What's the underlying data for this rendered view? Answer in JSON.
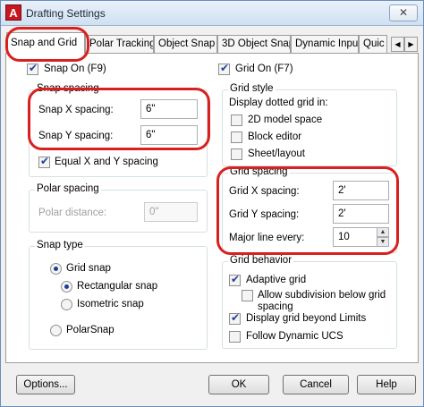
{
  "window": {
    "title": "Drafting Settings",
    "close_glyph": "✕",
    "app_icon_letter": "A"
  },
  "tabs": [
    "Snap and Grid",
    "Polar Tracking",
    "Object Snap",
    "3D Object Snap",
    "Dynamic Input",
    "Quic"
  ],
  "snap": {
    "snap_on_label": "Snap On (F9)",
    "snap_on_checked": true,
    "spacing_group": "Snap spacing",
    "x_label": "Snap X spacing:",
    "x_value": "6\"",
    "y_label": "Snap Y spacing:",
    "y_value": "6\"",
    "equal_label": "Equal X and Y spacing",
    "equal_checked": true
  },
  "polar": {
    "group": "Polar spacing",
    "distance_label": "Polar distance:",
    "distance_value": "0\""
  },
  "snap_type": {
    "group": "Snap type",
    "grid_snap": "Grid snap",
    "rectangular": "Rectangular snap",
    "isometric": "Isometric snap",
    "polarsnap": "PolarSnap"
  },
  "grid": {
    "grid_on_label": "Grid On (F7)",
    "grid_on_checked": true,
    "style_group": "Grid style",
    "style_desc": "Display dotted grid in:",
    "model_space": "2D model space",
    "block_editor": "Block editor",
    "sheet_layout": "Sheet/layout"
  },
  "grid_spacing": {
    "group": "Grid spacing",
    "x_label": "Grid X spacing:",
    "x_value": "2'",
    "y_label": "Grid Y spacing:",
    "y_value": "2'",
    "major_label": "Major line every:",
    "major_value": "10"
  },
  "grid_behavior": {
    "group": "Grid behavior",
    "adaptive": "Adaptive grid",
    "adaptive_checked": true,
    "allow_line1": "Allow subdivision below grid",
    "allow_line2": "spacing",
    "beyond_limits": "Display grid beyond Limits",
    "beyond_checked": true,
    "follow_ucs": "Follow Dynamic UCS"
  },
  "buttons": {
    "options": "Options...",
    "ok": "OK",
    "cancel": "Cancel",
    "help": "Help"
  }
}
